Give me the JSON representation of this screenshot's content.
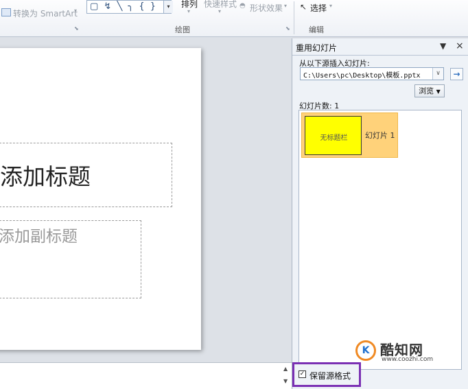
{
  "ribbon": {
    "convert_smartart": "转换为 SmartArt",
    "shape_glyphs": "▢ ↯ ╲ ╮ { }",
    "arrange": "排列",
    "quick_styles": "快速样式",
    "shape_effects": "形状效果",
    "select": "选择",
    "drawing_group": "绘图",
    "editing_group": "编辑"
  },
  "slide": {
    "title_placeholder": "添加标题",
    "subtitle_placeholder": "添加副标题"
  },
  "pane": {
    "title": "重用幻灯片",
    "insert_from_label": "从以下源插入幻灯片:",
    "source_path": "C:\\Users\\pc\\Desktop\\模板.pptx",
    "browse_label": "浏览",
    "slide_count_label": "幻灯片数: 1",
    "thumbnail_text": "无标题栏",
    "slide_label": "幻灯片 1",
    "keep_source_label": "保留源格式",
    "keep_source_checked": true
  },
  "watermark": {
    "brand": "酷知网",
    "url": "www.coozhi.com",
    "logo_letter": "K"
  }
}
